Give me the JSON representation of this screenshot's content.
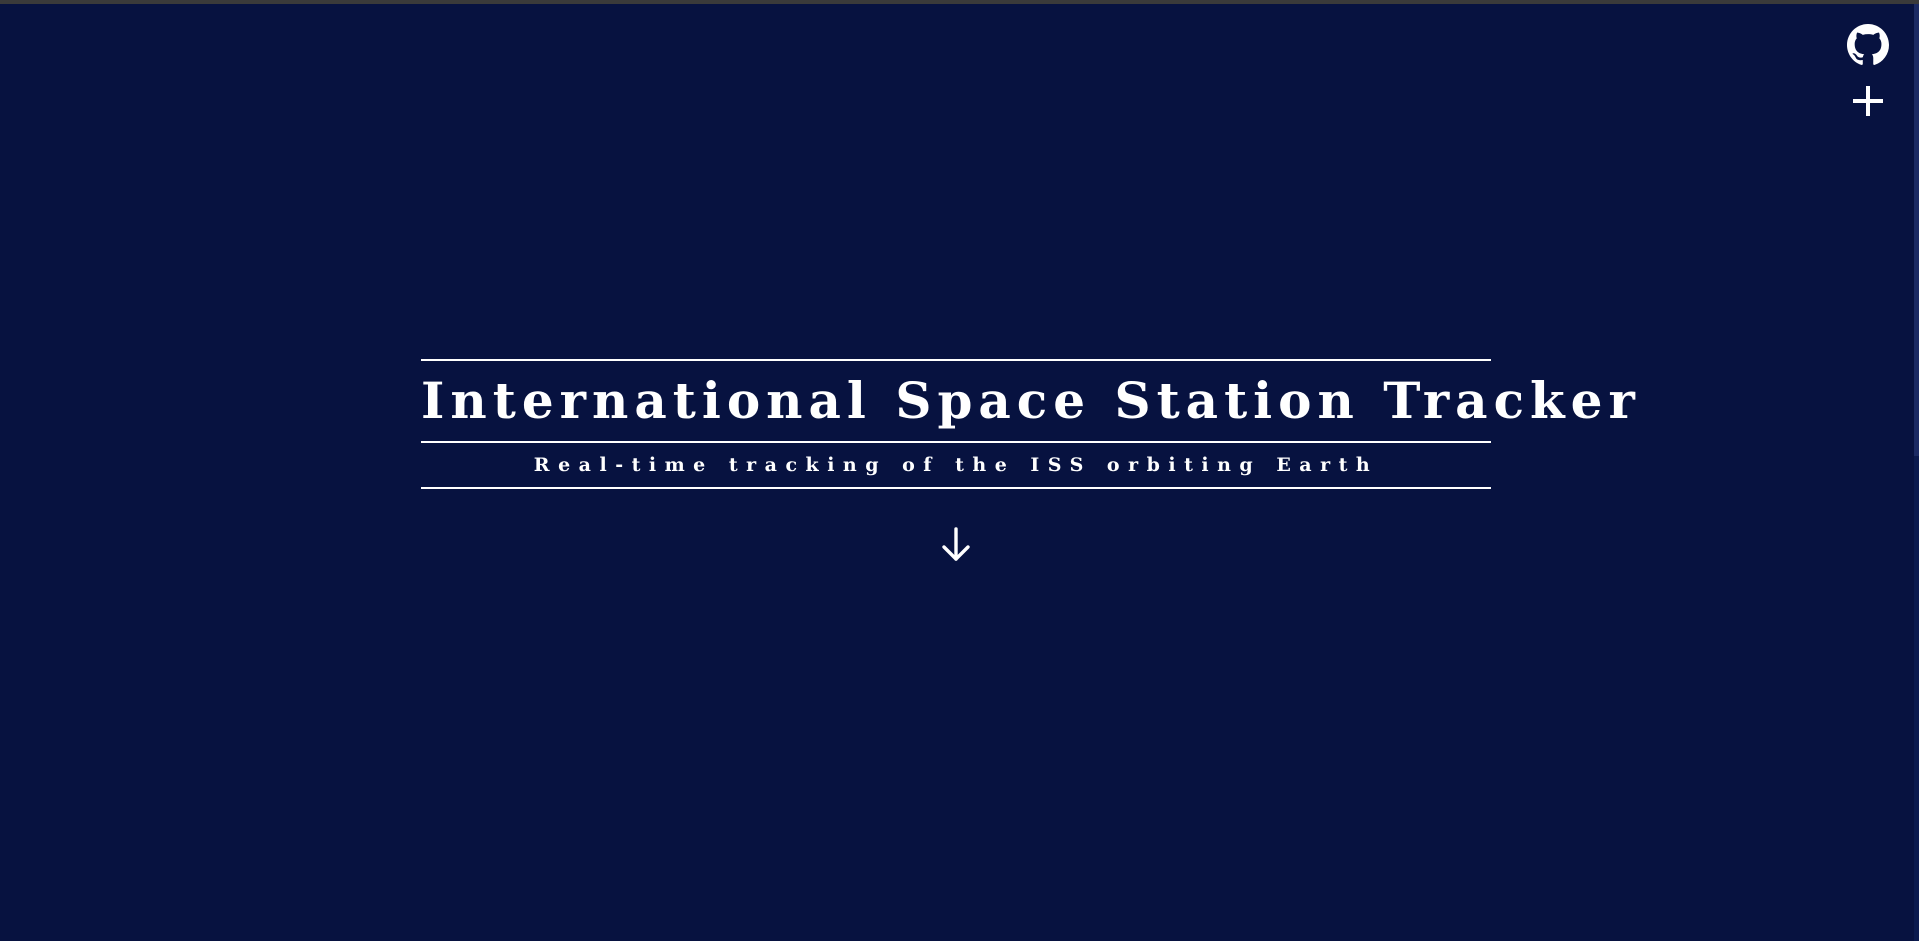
{
  "header": {
    "title": "International Space Station Tracker",
    "subtitle": "Real-time tracking of the ISS orbiting Earth"
  },
  "corner_icons": [
    {
      "icon": "github-icon"
    },
    {
      "icon": "plus-icon"
    }
  ],
  "scroll_hint": {
    "icon": "arrow-down-icon"
  },
  "colors": {
    "background": "#071240",
    "text": "#ffffff",
    "rule": "#ffffff"
  }
}
